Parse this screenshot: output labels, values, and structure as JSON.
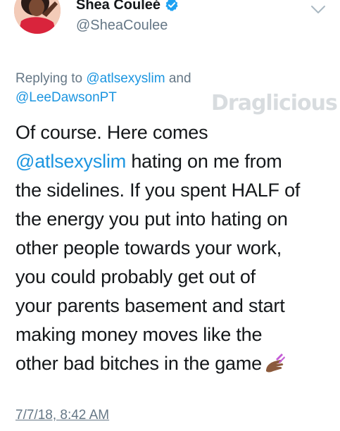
{
  "tweet": {
    "display_name": "Shea Couleé",
    "handle": "@SheaCoulee",
    "verified": true,
    "reply": {
      "prefix": "Replying to ",
      "mention_1": "@atlsexyslim",
      "connector": " and",
      "mention_2": "@LeeDawsonPT"
    },
    "watermark": "Draglicious",
    "text_lines": {
      "line1": "Of course. Here comes",
      "line2_mention": "@atlsexyslim",
      "line2_rest": " hating on me from",
      "line3": "the sidelines. If you spent HALF of",
      "line4": "the energy you put into hating on",
      "line5": "other people towards your work,",
      "line6": "you could probably get out of",
      "line7": "your parents basement and start",
      "line8": "making money moves like the",
      "line9": "other bad bitches in the game"
    },
    "emoji": "nail-polish-emoji",
    "timestamp": "7/7/18, 8:42 AM"
  },
  "colors": {
    "link": "#1b95e0",
    "secondary_text": "#657786",
    "primary_text": "#14171a",
    "verified_badge": "#1da1f2"
  }
}
